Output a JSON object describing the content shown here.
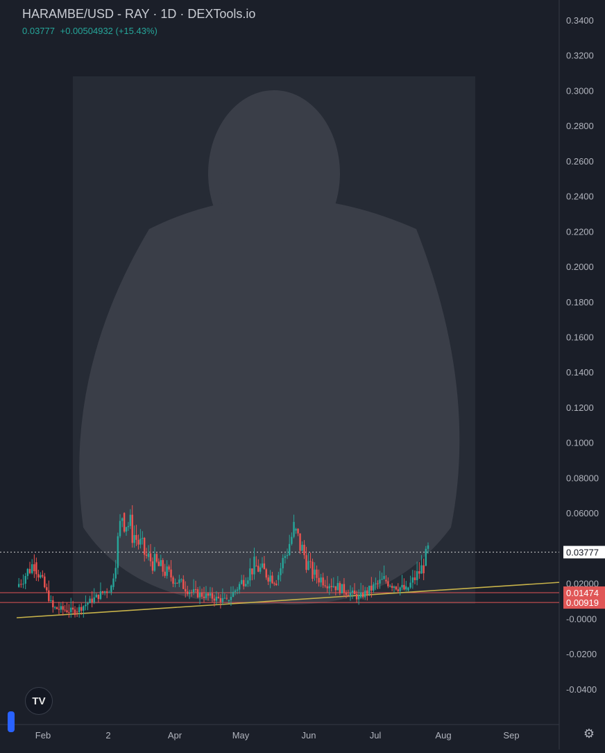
{
  "header": {
    "title": "HARAMBE/USD - RAY · 1D · DEXTools.io",
    "price": "0.03777",
    "change": "+0.00504932 (+15.43%)"
  },
  "logo_text": "TV",
  "colors": {
    "up": "#26a69a",
    "down": "#ef5350",
    "trendline": "#c8b34a",
    "hline": "#e05656",
    "background": "#1a1e28",
    "axis_text": "#b2b5be"
  },
  "chart_data": {
    "type": "candlestick",
    "title": "HARAMBE/USD - RAY · 1D · DEXTools.io",
    "y_ticks": [
      "0.3400",
      "0.3200",
      "0.3000",
      "0.2800",
      "0.2600",
      "0.2400",
      "0.2200",
      "0.2000",
      "0.1800",
      "0.1600",
      "0.1400",
      "0.1200",
      "0.1000",
      "0.08000",
      "0.06000",
      "0.02000",
      "-0.0000",
      "-0.0200",
      "-0.0400"
    ],
    "ylim": [
      -0.044,
      0.3435
    ],
    "x_ticks": [
      "Feb",
      "2",
      "Apr",
      "May",
      "Jun",
      "Jul",
      "Aug",
      "Sep"
    ],
    "current_price": {
      "label": "0.03777",
      "value": 0.03777
    },
    "horizontal_lines": [
      {
        "label": "0.01474",
        "value": 0.01474
      },
      {
        "label": "0.00919",
        "value": 0.00919
      }
    ],
    "trendline": {
      "from": {
        "x": "Jan 22",
        "y": 0.0005
      },
      "to": {
        "x": "Sep 22",
        "y": 0.0206
      }
    },
    "series": [
      {
        "segments": [
          {
            "start": "Jan 22",
            "end": "Jan 30",
            "from": 0.018,
            "to": 0.032
          },
          {
            "start": "Jan 30",
            "end": "Feb 8",
            "from": 0.032,
            "to": 0.006
          },
          {
            "start": "Feb 8",
            "end": "Feb 18",
            "from": 0.006,
            "to": 0.004
          },
          {
            "start": "Feb 18",
            "end": "Mar 4",
            "from": 0.004,
            "to": 0.018
          },
          {
            "start": "Mar 4",
            "end": "Mar 9",
            "from": 0.018,
            "to": 0.06
          },
          {
            "start": "Mar 9",
            "end": "Mar 20",
            "from": 0.06,
            "to": 0.035
          },
          {
            "start": "Mar 20",
            "end": "Apr 10",
            "from": 0.035,
            "to": 0.015
          },
          {
            "start": "Apr 10",
            "end": "Apr 26",
            "from": 0.015,
            "to": 0.01
          },
          {
            "start": "Apr 26",
            "end": "May 8",
            "from": 0.01,
            "to": 0.03
          },
          {
            "start": "May 8",
            "end": "May 18",
            "from": 0.03,
            "to": 0.022
          },
          {
            "start": "May 18",
            "end": "May 26",
            "from": 0.022,
            "to": 0.05
          },
          {
            "start": "May 26",
            "end": "Jun 4",
            "from": 0.05,
            "to": 0.025
          },
          {
            "start": "Jun 4",
            "end": "Jun 25",
            "from": 0.025,
            "to": 0.012
          },
          {
            "start": "Jun 25",
            "end": "Jul 6",
            "from": 0.012,
            "to": 0.022
          },
          {
            "start": "Jul 6",
            "end": "Jul 16",
            "from": 0.022,
            "to": 0.016
          },
          {
            "start": "Jul 16",
            "end": "Jul 24",
            "from": 0.016,
            "to": 0.03
          },
          {
            "start": "Jul 24",
            "end": "Jul 26",
            "from": 0.03,
            "to": 0.0378
          }
        ]
      }
    ]
  }
}
